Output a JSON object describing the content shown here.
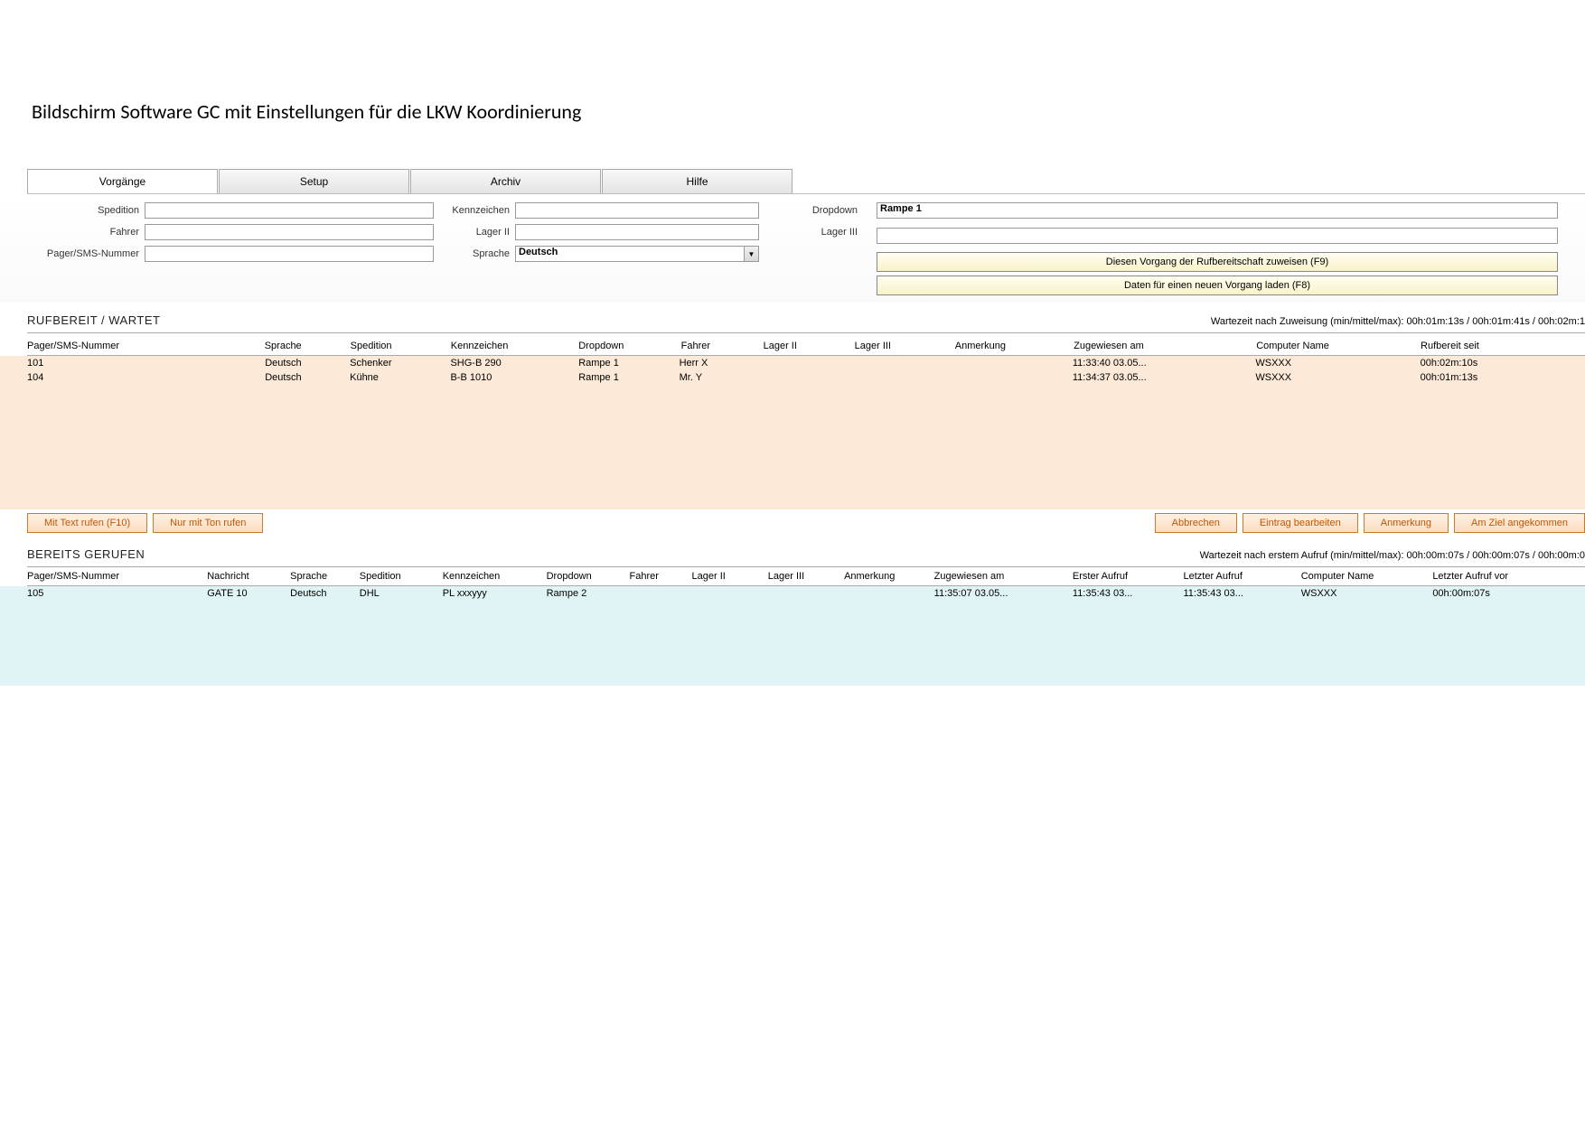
{
  "page": {
    "title": "Bildschirm Software GC  mit Einstellungen für die LKW Koordinierung"
  },
  "menubar": [
    {
      "label": "Vorgänge",
      "active": true
    },
    {
      "label": "Setup"
    },
    {
      "label": "Archiv"
    },
    {
      "label": "Hilfe"
    }
  ],
  "form": {
    "col1": {
      "spedition_label": "Spedition",
      "fahrer_label": "Fahrer",
      "pager_label": "Pager/SMS-Nummer",
      "spedition_value": "",
      "fahrer_value": "",
      "pager_value": ""
    },
    "col2": {
      "kennzeichen_label": "Kennzeichen",
      "lager2_label": "Lager II",
      "sprache_label": "Sprache",
      "kennzeichen_value": "",
      "lager2_value": "",
      "sprache_value": "Deutsch"
    },
    "col3": {
      "dropdown_label": "Dropdown",
      "lager3_label": "Lager III",
      "dropdown_value": "Rampe 1",
      "lager3_value": ""
    },
    "buttons": {
      "assign": "Diesen Vorgang der Rufbereitschaft zuweisen (F9)",
      "load": "Daten für einen neuen Vorgang laden (F8)"
    }
  },
  "ready": {
    "title": "RUFBEREIT / WARTET",
    "stat": "Wartezeit nach Zuweisung (min/mittel/max): 00h:01m:13s / 00h:01m:41s / 00h:02m:1",
    "headers": [
      "Pager/SMS-Nummer",
      "Sprache",
      "Spedition",
      "Kennzeichen",
      "Dropdown",
      "Fahrer",
      "Lager II",
      "Lager III",
      "Anmerkung",
      "Zugewiesen am",
      "Computer Name",
      "Rufbereit seit"
    ],
    "rows": [
      [
        "101",
        "Deutsch",
        "Schenker",
        "SHG-B 290",
        "Rampe 1",
        "Herr X",
        "",
        "",
        "",
        "11:33:40 03.05...",
        "WSXXX",
        "00h:02m:10s"
      ],
      [
        "104",
        "Deutsch",
        "Kühne",
        "B-B 1010",
        "Rampe 1",
        "Mr. Y",
        "",
        "",
        "",
        "11:34:37 03.05...",
        "WSXXX",
        "00h:01m:13s"
      ]
    ]
  },
  "actions": {
    "call_text": "Mit Text rufen (F10)",
    "call_sound": "Nur mit Ton rufen",
    "cancel": "Abbrechen",
    "edit": "Eintrag bearbeiten",
    "note": "Anmerkung",
    "arrived": "Am Ziel angekommen"
  },
  "called": {
    "title": "BEREITS GERUFEN",
    "stat": "Wartezeit nach erstem Aufruf (min/mittel/max): 00h:00m:07s / 00h:00m:07s / 00h:00m:0",
    "headers": [
      "Pager/SMS-Nummer",
      "Nachricht",
      "Sprache",
      "Spedition",
      "Kennzeichen",
      "Dropdown",
      "Fahrer",
      "Lager II",
      "Lager III",
      "Anmerkung",
      "Zugewiesen am",
      "Erster Aufruf",
      "Letzter Aufruf",
      "Computer Name",
      "Letzter Aufruf vor"
    ],
    "rows": [
      [
        "105",
        "GATE 10",
        "Deutsch",
        "DHL",
        "PL xxxyyy",
        "Rampe 2",
        "",
        "",
        "",
        "",
        "11:35:07 03.05...",
        "11:35:43 03...",
        "11:35:43 03...",
        "WSXXX",
        "00h:00m:07s"
      ]
    ]
  }
}
